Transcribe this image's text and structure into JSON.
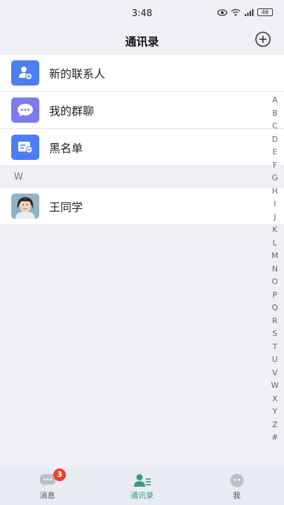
{
  "status_bar": {
    "time": "3:48",
    "battery": "46",
    "icons": [
      "eye-icon",
      "wifi-icon",
      "signal-icon",
      "battery-icon"
    ]
  },
  "header": {
    "title": "通讯录",
    "add_icon": "plus-circle-icon"
  },
  "menu_items": [
    {
      "label": "新的联系人",
      "icon": "add-contact-icon",
      "color": "#4c7ef2"
    },
    {
      "label": "我的群聊",
      "icon": "chat-bubble-icon",
      "color": "#7e7af0"
    },
    {
      "label": "黑名单",
      "icon": "blacklist-card-icon",
      "color": "#4c7ef2"
    }
  ],
  "section": {
    "letter": "W"
  },
  "contacts": [
    {
      "name": "王同学",
      "avatar": "avatar-image"
    }
  ],
  "index_letters": [
    "A",
    "B",
    "C",
    "D",
    "E",
    "F",
    "G",
    "H",
    "I",
    "J",
    "K",
    "L",
    "M",
    "N",
    "O",
    "P",
    "Q",
    "R",
    "S",
    "T",
    "U",
    "V",
    "W",
    "X",
    "Y",
    "Z",
    "#"
  ],
  "tabs": [
    {
      "label": "消息",
      "icon": "message-icon",
      "badge": "3"
    },
    {
      "label": "通讯录",
      "icon": "contacts-icon",
      "active": true
    },
    {
      "label": "我",
      "icon": "profile-icon"
    }
  ],
  "colors": {
    "accent": "#3a9c7b",
    "primary": "#4c7ef2",
    "badge": "#e8432f"
  }
}
